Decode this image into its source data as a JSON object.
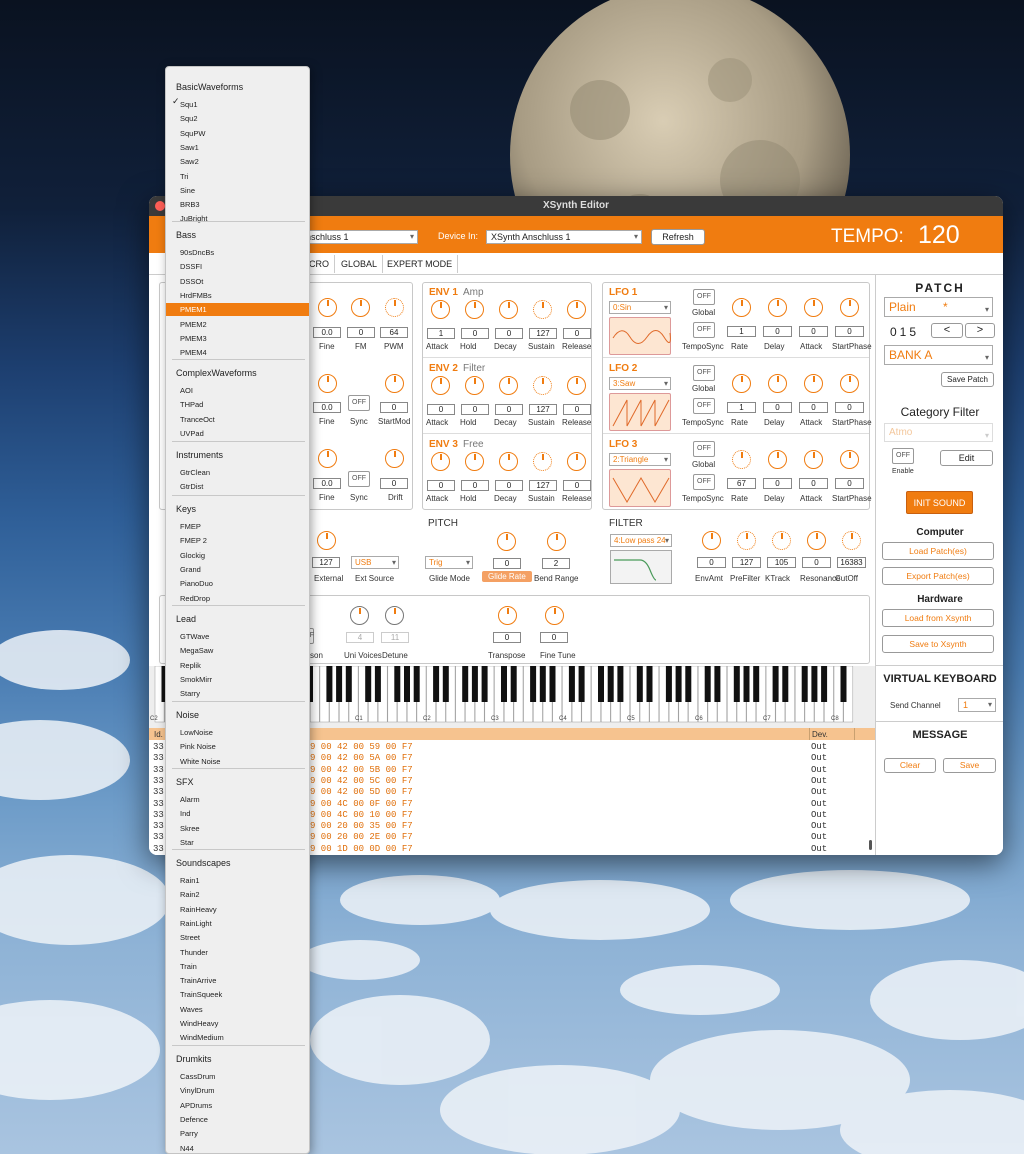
{
  "window": {
    "title": "XSynth Editor"
  },
  "header": {
    "device_out_value": "nschluss 1",
    "device_in_label": "Device In:",
    "device_in_value": "XSynth Anschluss 1",
    "refresh_label": "Refresh",
    "tempo_label": "TEMPO:",
    "tempo_value": "120"
  },
  "tabs": [
    "CRO",
    "GLOBAL",
    "EXPERT MODE"
  ],
  "osc": {
    "rows": [
      {
        "values": [
          "0.0",
          "0",
          "64"
        ],
        "labels": [
          "Fine",
          "FM",
          "PWM"
        ]
      },
      {
        "values": [
          "0.0",
          "OFF",
          "0"
        ],
        "labels": [
          "Fine",
          "Sync",
          "StartMod"
        ]
      },
      {
        "values": [
          "0.0",
          "OFF",
          "0"
        ],
        "labels": [
          "Fine",
          "Sync",
          "Drift"
        ]
      }
    ]
  },
  "env": [
    {
      "title": "ENV 1",
      "sub": "Amp",
      "values": [
        "1",
        "0",
        "0",
        "127",
        "0"
      ]
    },
    {
      "title": "ENV 2",
      "sub": "Filter",
      "values": [
        "0",
        "0",
        "0",
        "127",
        "0"
      ]
    },
    {
      "title": "ENV 3",
      "sub": "Free",
      "values": [
        "0",
        "0",
        "0",
        "127",
        "0"
      ]
    }
  ],
  "env_labels": [
    "Attack",
    "Hold",
    "Decay",
    "Sustain",
    "Release"
  ],
  "lfo": [
    {
      "title": "LFO 1",
      "wave": "0:Sin",
      "global": "OFF",
      "tsync": "OFF",
      "values": [
        "1",
        "0",
        "0",
        "0"
      ]
    },
    {
      "title": "LFO 2",
      "wave": "3:Saw",
      "global": "OFF",
      "tsync": "OFF",
      "values": [
        "1",
        "0",
        "0",
        "0"
      ]
    },
    {
      "title": "LFO 3",
      "wave": "2:Triangle",
      "global": "OFF",
      "tsync": "OFF",
      "values": [
        "67",
        "0",
        "0",
        "0"
      ]
    }
  ],
  "lfo_labels": {
    "global": "Global",
    "tsync": "TempoSync",
    "rate": "Rate",
    "delay": "Delay",
    "attack": "Attack",
    "startphase": "StartPhase"
  },
  "mix": {
    "external_value": "127",
    "external_label": "External",
    "source_value": "USB",
    "source_label": "Ext Source"
  },
  "pitch": {
    "title": "PITCH",
    "mode_value": "Trig",
    "mode_label": "Glide Mode",
    "glide_value": "0",
    "glide_label": "Glide Rate",
    "bend_value": "2",
    "bend_label": "Bend Range"
  },
  "filter": {
    "title": "FILTER",
    "type": "4:Low pass 24",
    "values": [
      "0",
      "127",
      "105",
      "0",
      "16383"
    ],
    "labels": [
      "EnvAmt",
      "PreFilter",
      "KTrack",
      "Resonance",
      "CutOff"
    ]
  },
  "voice": {
    "off": "OFF",
    "unison_label": "son",
    "uni_voices_value": "4",
    "uni_voices_label": "Uni Voices",
    "detune_value": "11",
    "detune_label": "Detune",
    "transpose_value": "0",
    "transpose_label": "Transpose",
    "finetune_value": "0",
    "finetune_label": "Fine Tune"
  },
  "keyboard": {
    "octaves": [
      "C2",
      "C1",
      "C2",
      "C3",
      "C4",
      "C5",
      "C6",
      "C7",
      "C8"
    ]
  },
  "log": {
    "col_id": "Id.",
    "col_dev": "Dev.",
    "rows": [
      {
        "id": "33",
        "data": "9 00 42 00 59 00 F7",
        "dev": "Out"
      },
      {
        "id": "33",
        "data": "9 00 42 00 5A 00 F7",
        "dev": "Out"
      },
      {
        "id": "33",
        "data": "9 00 42 00 5B 00 F7",
        "dev": "Out"
      },
      {
        "id": "33",
        "data": "9 00 42 00 5C 00 F7",
        "dev": "Out"
      },
      {
        "id": "33",
        "data": "9 00 42 00 5D 00 F7",
        "dev": "Out"
      },
      {
        "id": "33",
        "data": "9 00 4C 00 0F 00 F7",
        "dev": "Out"
      },
      {
        "id": "33",
        "data": "9 00 4C 00 10 00 F7",
        "dev": "Out"
      },
      {
        "id": "33",
        "data": "9 00 20 00 35 00 F7",
        "dev": "Out"
      },
      {
        "id": "33",
        "data": "9 00 20 00 2E 00 F7",
        "dev": "Out"
      },
      {
        "id": "33",
        "data": "9 00 1D 00 0D 00 F7",
        "dev": "Out"
      }
    ]
  },
  "sidebar": {
    "patch_title": "PATCH",
    "patch_value": "Plain",
    "patch_mark": "*",
    "patch_num": "015",
    "prev": "<",
    "next": ">",
    "bank": "BANK A",
    "save_patch": "Save Patch",
    "category_title": "Category Filter",
    "category_value": "Atmo",
    "enable_value": "OFF",
    "enable_label": "Enable",
    "edit": "Edit",
    "init": "INIT SOUND",
    "computer_title": "Computer",
    "load_patches": "Load Patch(es)",
    "export_patches": "Export Patch(es)",
    "hardware_title": "Hardware",
    "load_xsynth": "Load from Xsynth",
    "save_xsynth": "Save to Xsynth",
    "vk_title": "VIRTUAL KEYBOARD",
    "send_channel_label": "Send Channel",
    "send_channel_value": "1",
    "message_title": "MESSAGE",
    "clear": "Clear",
    "save": "Save"
  },
  "menu": {
    "checked": "✓",
    "groups": [
      {
        "title": "BasicWaveforms",
        "items": [
          "Squ1",
          "Squ2",
          "SquPW",
          "Saw1",
          "Saw2",
          "Tri",
          "Sine",
          "BRB3",
          "JuBright"
        ]
      },
      {
        "title": "Bass",
        "items": [
          "90sDncBs",
          "DSSFI",
          "DSSOt",
          "HrdFMBs",
          "PMEM1",
          "PMEM2",
          "PMEM3",
          "PMEM4"
        ]
      },
      {
        "title": "ComplexWaveforms",
        "items": [
          "AOI",
          "THPad",
          "TranceOct",
          "UVPad"
        ]
      },
      {
        "title": "Instruments",
        "items": [
          "GtrClean",
          "GtrDist"
        ]
      },
      {
        "title": "Keys",
        "items": [
          "FMEP",
          "FMEP 2",
          "Glockig",
          "Grand",
          "PianoDuo",
          "RedDrop"
        ]
      },
      {
        "title": "Lead",
        "items": [
          "GTWave",
          "MegaSaw",
          "Replik",
          "SmokMirr",
          "Starry"
        ]
      },
      {
        "title": "Noise",
        "items": [
          "LowNoise",
          "Pink Noise",
          "White Noise"
        ]
      },
      {
        "title": "SFX",
        "items": [
          "Alarm",
          "Ind",
          "Skree",
          "Star"
        ]
      },
      {
        "title": "Soundscapes",
        "items": [
          "Rain1",
          "Rain2",
          "RainHeavy",
          "RainLight",
          "Street",
          "Thunder",
          "Train",
          "TrainArrive",
          "TrainSqueek",
          "Waves",
          "WindHeavy",
          "WindMedium"
        ]
      },
      {
        "title": "Drumkits",
        "items": [
          "CassDrum",
          "VinylDrum",
          "APDrums",
          "Defence",
          "Parry",
          "N44"
        ]
      }
    ]
  }
}
